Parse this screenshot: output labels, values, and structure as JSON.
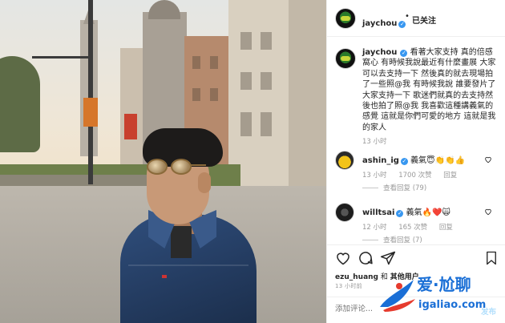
{
  "header": {
    "username": "jaychou",
    "separator": "•",
    "follow_status": "已关注"
  },
  "caption": {
    "username": "jaychou",
    "text": "看著大家支持 真的倍感窩心 有時候我說最近有什麼畫展 大家可以去支持一下 然後真的就去現場拍了一些照@我 有時候我說 誰要發片了 大家支持一下 歌迷們就真的去支持然後也拍了照@我 我喜歡這種講義氣的感覺 這就是你們可愛的地方 這就是我的家人",
    "time": "13 小时"
  },
  "comments": [
    {
      "username": "ashin_ig",
      "text": "義氣",
      "emoji": "😇👏👏👍",
      "time": "13 小时",
      "likes": "1700 次赞",
      "reply_label": "回复",
      "view_replies": "查看回复 (79)"
    },
    {
      "username": "willtsai",
      "text": "義氣",
      "emoji": "🔥❤️🙀",
      "time": "12 小时",
      "likes": "165 次赞",
      "reply_label": "回复",
      "view_replies": "查看回复 (7)"
    }
  ],
  "likes_line": {
    "user": "ezu_huang",
    "middle": "和",
    "others": "其他用户"
  },
  "post_time": "13 小时前",
  "add_comment": {
    "placeholder": "添加评论...",
    "post_label": "发布"
  },
  "watermark": {
    "title": "爱·尬聊",
    "url": "igaliao.com"
  },
  "icons": {
    "verified": "verified-badge-icon",
    "like": "heart-icon",
    "comment": "comment-bubble-icon",
    "share": "paper-plane-icon",
    "save": "bookmark-icon"
  },
  "colors": {
    "verified_blue": "#3897f0",
    "watermark_blue": "#1a6fd6",
    "muted_text": "#999999",
    "post_button": "#b2dffc"
  }
}
